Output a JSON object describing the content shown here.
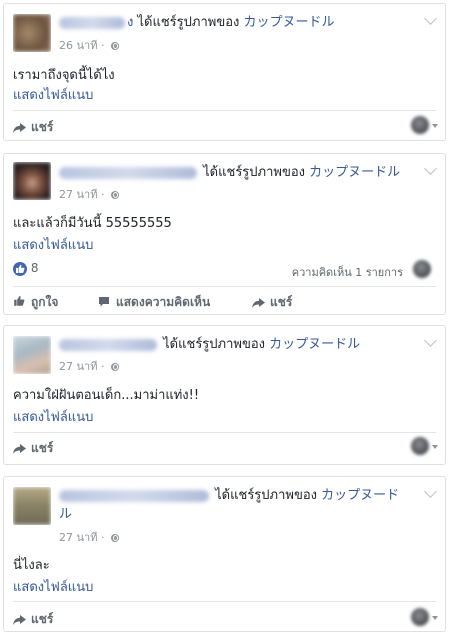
{
  "posts": [
    {
      "action_text": "ได้แชร์รูปภาพของ",
      "name_tail": "ง",
      "page_name": "カップヌードル",
      "time": "26 นาที ·",
      "body": "เรามาถึงจุดนี้ได้ไง",
      "attachment": "แสดงไฟล์แนบ",
      "share": "แชร์"
    },
    {
      "action_text": "ได้แชร์รูปภาพของ",
      "page_name": "カップヌードル",
      "time": "27 นาที ·",
      "body": "และแล้วก็มีวันนี้ 55555555",
      "attachment": "แสดงไฟล์แนบ",
      "like_count": "8",
      "comments": "ความคิดเห็น 1 รายการ",
      "like": "ถูกใจ",
      "comment": "แสดงความคิดเห็น",
      "share": "แชร์"
    },
    {
      "action_text": "ได้แชร์รูปภาพของ",
      "page_name": "カップヌードル",
      "time": "27 นาที ·",
      "body": "ความใฝ่ฝันตอนเด็ก...มาม่าแท่ง!!",
      "attachment": "แสดงไฟล์แนบ",
      "share": "แชร์"
    },
    {
      "action_text": "ได้แชร์รูปภาพของ",
      "page_name_line1": "カップヌード",
      "page_name_line2": "ル",
      "time": "27 นาที ·",
      "body": "นี่ไงละ",
      "attachment": "แสดงไฟล์แนบ",
      "share": "แชร์"
    }
  ],
  "colors": {
    "link": "#365899",
    "meta": "#90949c",
    "like_blue": "#4267b2",
    "border": "#dddfe2"
  }
}
